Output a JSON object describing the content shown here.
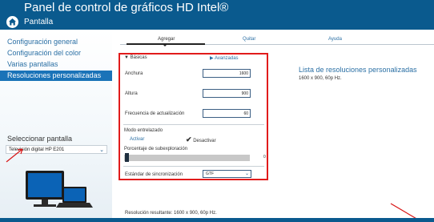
{
  "header": {
    "title": "Panel de control de gráficos HD Intel®",
    "subtitle": "Pantalla"
  },
  "sidebar": {
    "items": [
      {
        "label": "Configuración general"
      },
      {
        "label": "Configuración del color"
      },
      {
        "label": "Varias pantallas"
      },
      {
        "label": "Resoluciones personalizadas"
      }
    ],
    "select_label": "Seleccionar pantalla",
    "selected_display": "Televisión digital HP E201"
  },
  "tabs": [
    {
      "label": "Agregar"
    },
    {
      "label": "Quitar"
    },
    {
      "label": "Ayuda"
    }
  ],
  "form": {
    "basic_label": "Básicas",
    "advanced_label": "Avanzadas",
    "width_label": "Anchura",
    "width_value": "1600",
    "height_label": "Altura",
    "height_value": "900",
    "refresh_label": "Frecuencia de actualización",
    "refresh_value": "60",
    "interlaced_label": "Modo entrelazado",
    "activate_label": "Activar",
    "deactivate_label": "Desactivar",
    "underscan_label": "Porcentaje de subexploración",
    "underscan_percent": 0,
    "underscan_value": "0",
    "sync_label": "Estándar de sincronización",
    "sync_value": "GTF"
  },
  "custom_list": {
    "title": "Lista de resoluciones personalizadas",
    "items": [
      "1600 x 900, 60p Hz."
    ]
  },
  "footer": {
    "resulting_resolution": "Resolución resultante: 1600 x 900, 60p Hz."
  },
  "colors": {
    "header_blue": "#0a5a8e",
    "link_blue": "#2a6fa4",
    "active_blue": "#1a73b8",
    "highlight_red": "#e11b1b"
  }
}
